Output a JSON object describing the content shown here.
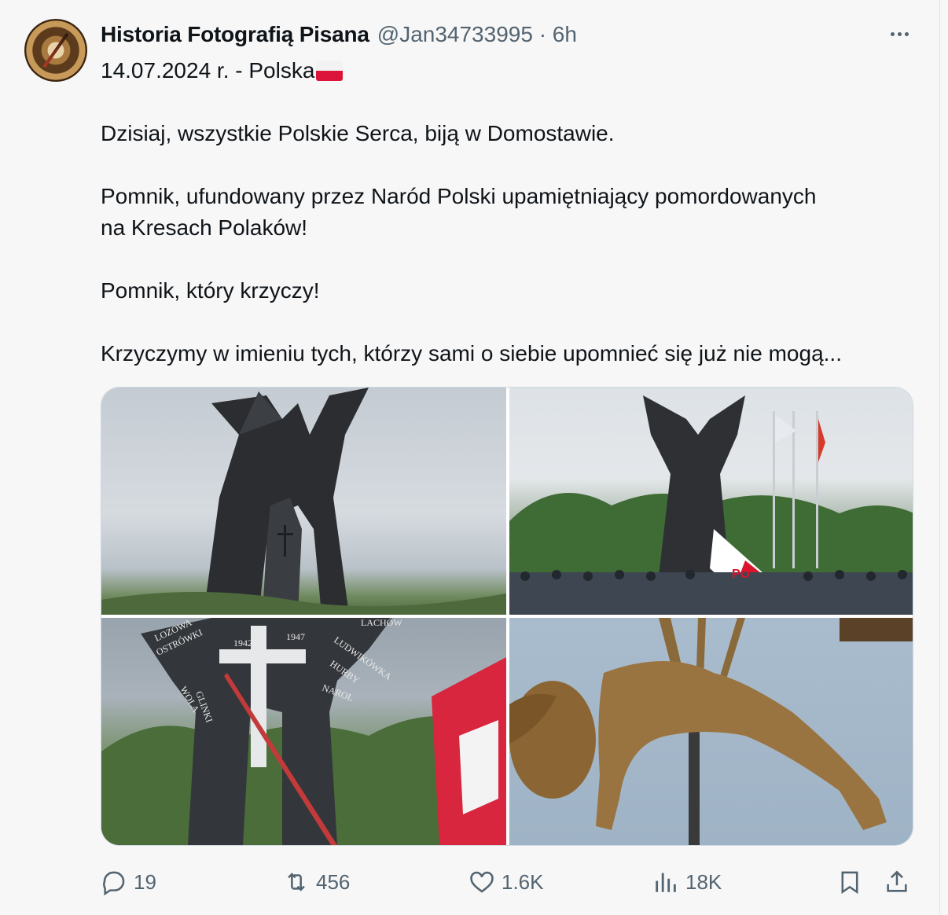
{
  "tweet": {
    "author_name": "Historia Fotografią Pisana",
    "author_handle": "@Jan34733995 · 6h",
    "lines": [
      "14.07.2024 r. - Polska",
      "Dzisiaj, wszystkie Polskie Serca, biją w Domostawie.",
      "Pomnik, ufundowany przez Naród Polski upamiętniający pomordowanych",
      "na Kresach Polaków!",
      "Pomnik, który krzyczy!",
      "Krzyczymy w imieniu tych, którzy sami o siebie upomnieć się już nie mogą..."
    ],
    "photo_texts": {
      "year_left": "1942",
      "year_right": "1947",
      "narol": "NAROL",
      "lozowa": "LOZOWA",
      "ostrowki": "OSTRÓWKI",
      "wola": "WOLA",
      "glinki": "GLINKI",
      "ludwikowka": "LUDWIKÓWKA",
      "hurby": "HURBY",
      "lachow": "LACHÓW",
      "banner": "PO"
    }
  },
  "actions": {
    "replies": "19",
    "reposts": "456",
    "likes": "1.6K",
    "views": "18K"
  },
  "colors": {
    "text": "#0f1419",
    "muted": "#536471",
    "border": "#cfd9de",
    "flag_red": "#dc143c"
  },
  "icons": [
    "avatar-compass",
    "more-dots-icon",
    "flag-poland-icon",
    "reply-icon",
    "repost-icon",
    "like-icon",
    "views-icon",
    "bookmark-icon",
    "share-icon"
  ]
}
